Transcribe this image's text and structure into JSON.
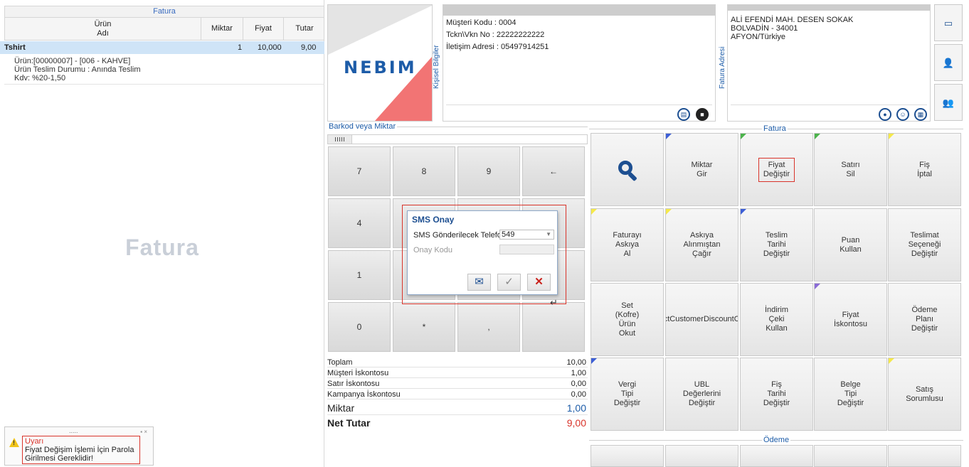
{
  "invoice_grid": {
    "title": "Fatura",
    "columns": {
      "product": "Ürün\nAdı",
      "qty": "Miktar",
      "price": "Fiyat",
      "total": "Tutar"
    },
    "rows": [
      {
        "name": "Tshirt",
        "qty": "1",
        "price": "10,000",
        "total": "9,00"
      }
    ],
    "detail_lines": [
      "Ürün:[00000007] - [006 - KAHVE]",
      "Ürün Teslim Durumu : Anında Teslim",
      "Kdv: %20-1,50"
    ],
    "watermark": "Fatura"
  },
  "warning": {
    "grip": ".....",
    "title": "Uyarı",
    "message": "Fiyat Değişim İşlemi İçin Parola Girilmesi Gereklidir!"
  },
  "logo": {
    "text": "NEBIM"
  },
  "customer": {
    "section_label": "Kişisel Bilgiler",
    "lines": [
      "Müşteri Kodu  : 0004",
      "Tckn\\Vkn No  : 22222222222",
      "İletişim Adresi : 05497914251"
    ]
  },
  "address": {
    "section_label": "Fatura Adresi",
    "lines": [
      "ALİ EFENDİ MAH. DESEN SOKAK",
      "BOLVADİN - 34001",
      "AFYON/Türkiye"
    ]
  },
  "barcode": {
    "label": "Barkod veya Miktar"
  },
  "numpad": {
    "keys": [
      "7",
      "8",
      "9",
      "←",
      "4",
      "",
      "",
      "",
      "1",
      "",
      "",
      "",
      "0",
      "*",
      ",",
      ""
    ]
  },
  "totals": {
    "rows": [
      {
        "label": "Toplam",
        "value": "10,00"
      },
      {
        "label": "Müşteri İskontosu",
        "value": "1,00"
      },
      {
        "label": "Satır İskontosu",
        "value": "0,00"
      },
      {
        "label": "Kampanya İskontosu",
        "value": "0,00"
      }
    ],
    "qty_label": "Miktar",
    "qty_value": "1,00",
    "net_label": "Net Tutar",
    "net_value": "9,00"
  },
  "functions": {
    "group_label": "Fatura",
    "buttons": [
      "",
      "Miktar\nGir",
      "Fiyat\nDeğiştir",
      "Satırı\nSil",
      "Fiş\nİptal",
      "Faturayı\nAskıya\nAl",
      "Askıya\nAlınmıştan\nÇağır",
      "Teslim\nTarihi\nDeğiştir",
      "Puan\nKullan",
      "Teslimat\nSeçeneği\nDeğiştir",
      "Set\n(Kofre)\nÜrün\nOkut",
      "ctCustomerDiscountO",
      "İndirim\nÇeki\nKullan",
      "Fiyat\nİskontosu",
      "Ödeme\nPlanı\nDeğiştir",
      "Vergi\nTipi\nDeğiştir",
      "UBL\nDeğerlerini\nDeğiştir",
      "Fiş\nTarihi\nDeğiştir",
      "Belge\nTipi\nDeğiştir",
      "Satış\nSorumlusu"
    ],
    "corner_colors": {
      "blue": "#3d5fd6",
      "green": "#4bb34b",
      "yellow": "#f5e94a",
      "purple": "#8a6bd6"
    }
  },
  "payment": {
    "group_label": "Ödeme"
  },
  "sms_dialog": {
    "title": "SMS Onay",
    "phone_label": "SMS Gönderilecek Telefon",
    "phone_value": "549",
    "code_label": "Onay Kodu"
  },
  "colors": {
    "accent": "#1d4f91",
    "alert": "#d9342b",
    "selected_row": "#cfe4f7",
    "total_blue": "#1d5ca8"
  }
}
